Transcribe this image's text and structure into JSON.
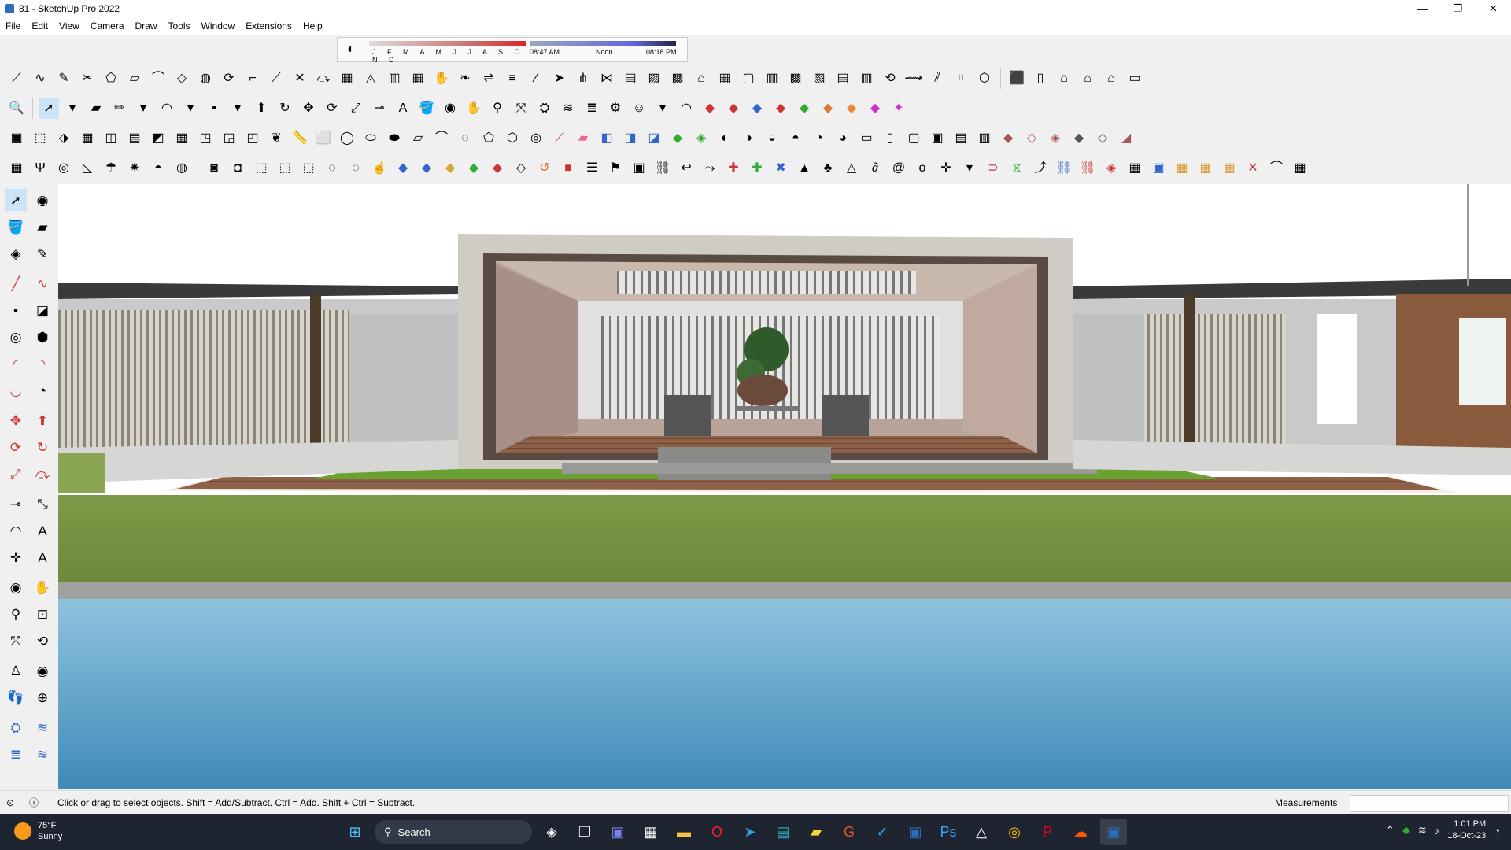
{
  "window": {
    "title": "81 - SketchUp Pro 2022",
    "buttons": [
      "—",
      "❐",
      "✕"
    ]
  },
  "menu": [
    "File",
    "Edit",
    "View",
    "Camera",
    "Draw",
    "Tools",
    "Window",
    "Extensions",
    "Help"
  ],
  "shadow_bar": {
    "months": "J F M A M J J A S O N D",
    "time_start": "08:47 AM",
    "time_mid": "Noon",
    "time_end": "08:18 PM"
  },
  "status": {
    "hint": "Click or drag to select objects. Shift = Add/Subtract. Ctrl = Add. Shift + Ctrl = Subtract.",
    "measurements_label": "Measurements",
    "measurements_value": ""
  },
  "taskbar": {
    "weather_temp": "75°F",
    "weather_cond": "Sunny",
    "search_placeholder": "Search",
    "time": "1:01 PM",
    "date": "18-Oct-23"
  },
  "colors": {
    "accent": "#2a6ebd",
    "grass": "#7a9a4a",
    "water": "#5aa0c8",
    "deck": "#8a5a44"
  }
}
